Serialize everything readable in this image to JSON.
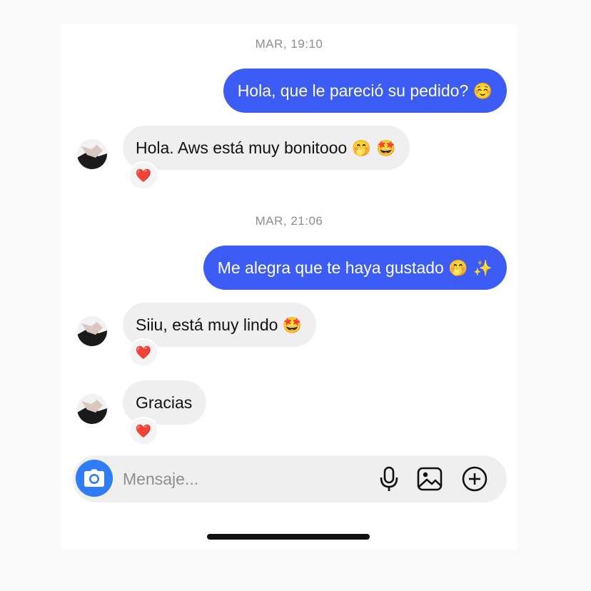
{
  "conversation": {
    "groups": [
      {
        "timestamp": "MAR, 19:10"
      },
      {
        "timestamp": "MAR, 21:06"
      }
    ],
    "messages": [
      {
        "direction": "outgoing",
        "text": "Hola, que le pareció su pedido?",
        "emoji": "☺️"
      },
      {
        "direction": "incoming",
        "text": "Hola. Aws está muy bonitooo",
        "emoji": "🤭 🤩",
        "reaction": "❤️"
      },
      {
        "direction": "outgoing",
        "text": "Me alegra que te haya gustado",
        "emoji": "🤭 ✨"
      },
      {
        "direction": "incoming",
        "text": "Siiu, está muy lindo",
        "emoji": "🤩",
        "reaction": "❤️"
      },
      {
        "direction": "incoming",
        "text": "Gracias",
        "reaction": "❤️"
      }
    ]
  },
  "composer": {
    "placeholder": "Mensaje...",
    "icons": [
      "camera-icon",
      "microphone-icon",
      "image-icon",
      "plus-circle-icon"
    ]
  },
  "colors": {
    "outgoing_bubble": "#3d5bf5",
    "incoming_bubble": "#efefef",
    "camera_button": "#2f7cf6",
    "reaction_heart": "#e8132b"
  }
}
